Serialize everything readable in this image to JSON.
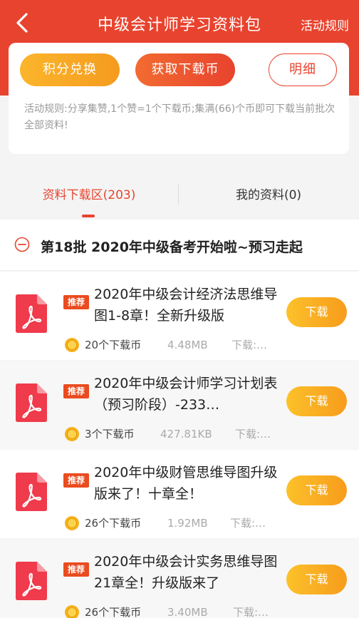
{
  "header": {
    "title": "中级会计师学习资料包",
    "rules_label": "活动规则"
  },
  "actions": {
    "points_label": "积分兑换",
    "coin_label": "获取下载币",
    "detail_label": "明细"
  },
  "rules_text": "活动规则:分享集赞,1个赞=1个下载币;集满(66)个币即可下载当前批次全部资料!",
  "tabs": [
    {
      "label": "资料下载区(203)",
      "active": true
    },
    {
      "label": "我的资料(0)",
      "active": false
    }
  ],
  "section": {
    "title": "第18批 2020年中级备考开始啦~预习走起"
  },
  "items": [
    {
      "name": "2020年中级会计经济法思维导图1-8章！全新升级版",
      "badge": "推荐",
      "coins": "20个下载币",
      "size": "4.48MB",
      "downloads": "下载:…",
      "button": "下载"
    },
    {
      "name": "2020年中级会计师学习计划表（预习阶段）-233…",
      "badge": "推荐",
      "coins": "3个下载币",
      "size": "427.81KB",
      "downloads": "下载:…",
      "button": "下载"
    },
    {
      "name": "2020年中级财管思维导图升级版来了！十章全！",
      "badge": "推荐",
      "coins": "26个下载币",
      "size": "1.92MB",
      "downloads": "下载:…",
      "button": "下载"
    },
    {
      "name": "2020年中级会计实务思维导图21章全！升级版来了",
      "badge": "推荐",
      "coins": "26个下载币",
      "size": "3.40MB",
      "downloads": "下载:…",
      "button": "下载"
    }
  ],
  "colors": {
    "brand_red": "#e8432e",
    "orange": "#f7a21f",
    "badge_red": "#ea4b1f"
  }
}
